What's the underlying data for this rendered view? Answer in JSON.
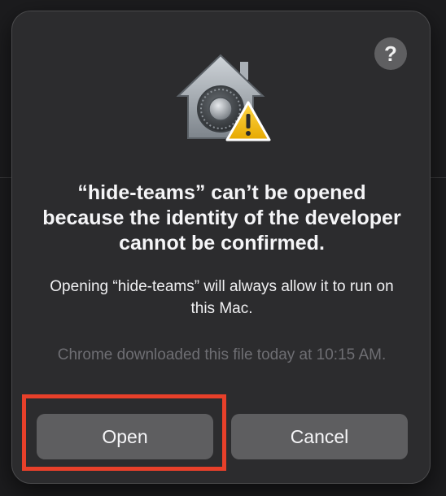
{
  "dialog": {
    "help_label": "?",
    "icon": "gatekeeper-lock-warning-icon",
    "title": "“hide-teams” can’t be opened because the identity of the developer cannot be confirmed.",
    "message": "Opening “hide-teams” will always allow it to run on this Mac.",
    "download_note": "Chrome downloaded this file today at 10:15 AM.",
    "open_label": "Open",
    "cancel_label": "Cancel"
  },
  "colors": {
    "dialog_background": "#2c2c2e",
    "button_background": "#5e5e60",
    "highlight": "#e8402a",
    "warning": "#f5c518"
  }
}
